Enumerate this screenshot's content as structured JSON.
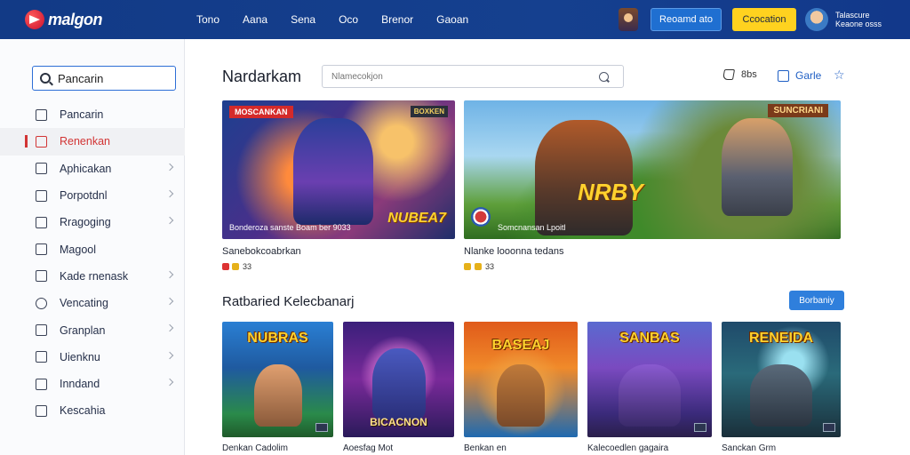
{
  "header": {
    "logo_text": "malgon",
    "nav": [
      "Tono",
      "Aana",
      "Sena",
      "Oco",
      "Brenor",
      "Gaoan"
    ],
    "btn_blue": "Reoamd ato",
    "btn_yellow": "Ccocation",
    "user_line1": "Talascure",
    "user_line2": "Keaone osss"
  },
  "sidebar": {
    "search_value": "Pancarin",
    "items": [
      {
        "label": "Pancarin",
        "icon": "calendar-icon",
        "chevron": false
      },
      {
        "label": "Renenkan",
        "icon": "fire-icon",
        "chevron": false,
        "active": true
      },
      {
        "label": "Aphicakan",
        "icon": "window-icon",
        "chevron": true
      },
      {
        "label": "Porpotdnl",
        "icon": "document-icon",
        "chevron": true
      },
      {
        "label": "Rragoging",
        "icon": "tag-icon",
        "chevron": true
      },
      {
        "label": "Magool",
        "icon": "check-icon",
        "chevron": false
      },
      {
        "label": "Kade rnenask",
        "icon": "home-icon",
        "chevron": true
      },
      {
        "label": "Vencating",
        "icon": "clock-icon",
        "chevron": true
      },
      {
        "label": "Granplan",
        "icon": "image-icon",
        "chevron": true
      },
      {
        "label": "Uienknu",
        "icon": "grid-icon",
        "chevron": true
      },
      {
        "label": "Inndand",
        "icon": "puzzle-icon",
        "chevron": true
      },
      {
        "label": "Kescahia",
        "icon": "bell-icon",
        "chevron": false
      }
    ]
  },
  "main": {
    "title": "Nardarkam",
    "search_placeholder": "Nlamecokjon",
    "like_count": "8bs",
    "game_label": "Garle",
    "colors": {
      "accent": "#1f5fc4",
      "active": "#d23535",
      "topbar": "#15408f"
    },
    "heroes": [
      {
        "badge": "MOSCANKAN",
        "badge_right": "BOXKEN",
        "logo": "NUBEA7",
        "caption": "Bonderoza sanste Boam ber 9033",
        "title": "Sanebokcoabrkan",
        "count": "33"
      },
      {
        "badge_right": "SUNCRIANI",
        "logo": "NRBY",
        "caption": "Somcnansan Lpoitl",
        "title": "Nlanke looonna tedans",
        "count": "33"
      }
    ],
    "section_title": "Ratbaried Kelecbanarj",
    "section_button": "Borbaniy",
    "cards": [
      {
        "logo": "NUBRAS",
        "sub": "",
        "caption": "Denkan Cadolim"
      },
      {
        "logo": "",
        "sub": "BICACNON",
        "caption": "Aoesfag Mot"
      },
      {
        "logo": "BASEAJ",
        "sub": "",
        "caption": "Benkan en"
      },
      {
        "logo": "SANBAS",
        "sub": "",
        "caption": "Kalecoedlen gagaira"
      },
      {
        "logo": "RENEIDA",
        "sub": "",
        "caption": "Sanckan Grm"
      }
    ]
  }
}
